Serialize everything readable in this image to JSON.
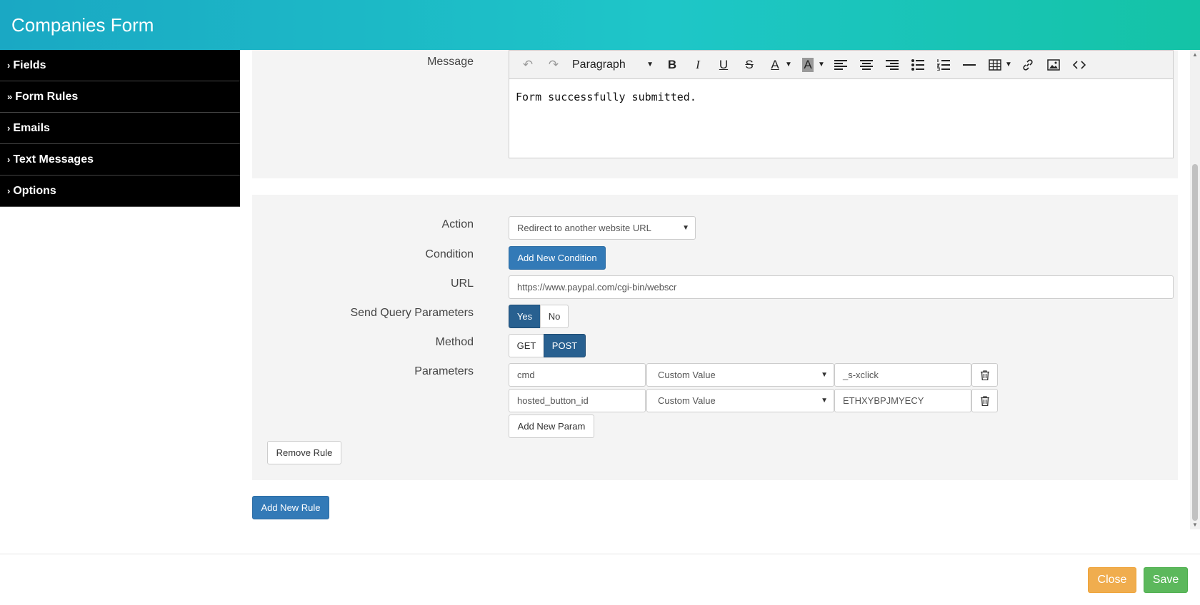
{
  "header": {
    "title": "Companies Form"
  },
  "sidebar": {
    "items": [
      {
        "label": "Fields",
        "chevron": "›"
      },
      {
        "label": "Form Rules",
        "chevron": "»"
      },
      {
        "label": "Emails",
        "chevron": "›"
      },
      {
        "label": "Text Messages",
        "chevron": "›"
      },
      {
        "label": "Options",
        "chevron": "›"
      }
    ]
  },
  "message": {
    "label": "Message",
    "format_select": "Paragraph",
    "body": "Form successfully submitted."
  },
  "rule": {
    "action_label": "Action",
    "action_value": "Redirect to another website URL",
    "condition_label": "Condition",
    "add_condition": "Add New Condition",
    "url_label": "URL",
    "url_value": "https://www.paypal.com/cgi-bin/webscr",
    "send_query_label": "Send Query Parameters",
    "yes": "Yes",
    "no": "No",
    "method_label": "Method",
    "get": "GET",
    "post": "POST",
    "parameters_label": "Parameters",
    "params": [
      {
        "name": "cmd",
        "type": "Custom Value",
        "value": "_s-xclick"
      },
      {
        "name": "hosted_button_id",
        "type": "Custom Value",
        "value": "ETHXYBPJMYECY"
      }
    ],
    "add_param": "Add New Param",
    "remove_rule": "Remove Rule"
  },
  "add_rule": "Add New Rule",
  "footer": {
    "close": "Close",
    "save": "Save"
  },
  "colors": {
    "primary": "#337ab7",
    "active": "#286090",
    "close": "#f0ad4e",
    "save": "#5cb85c"
  }
}
